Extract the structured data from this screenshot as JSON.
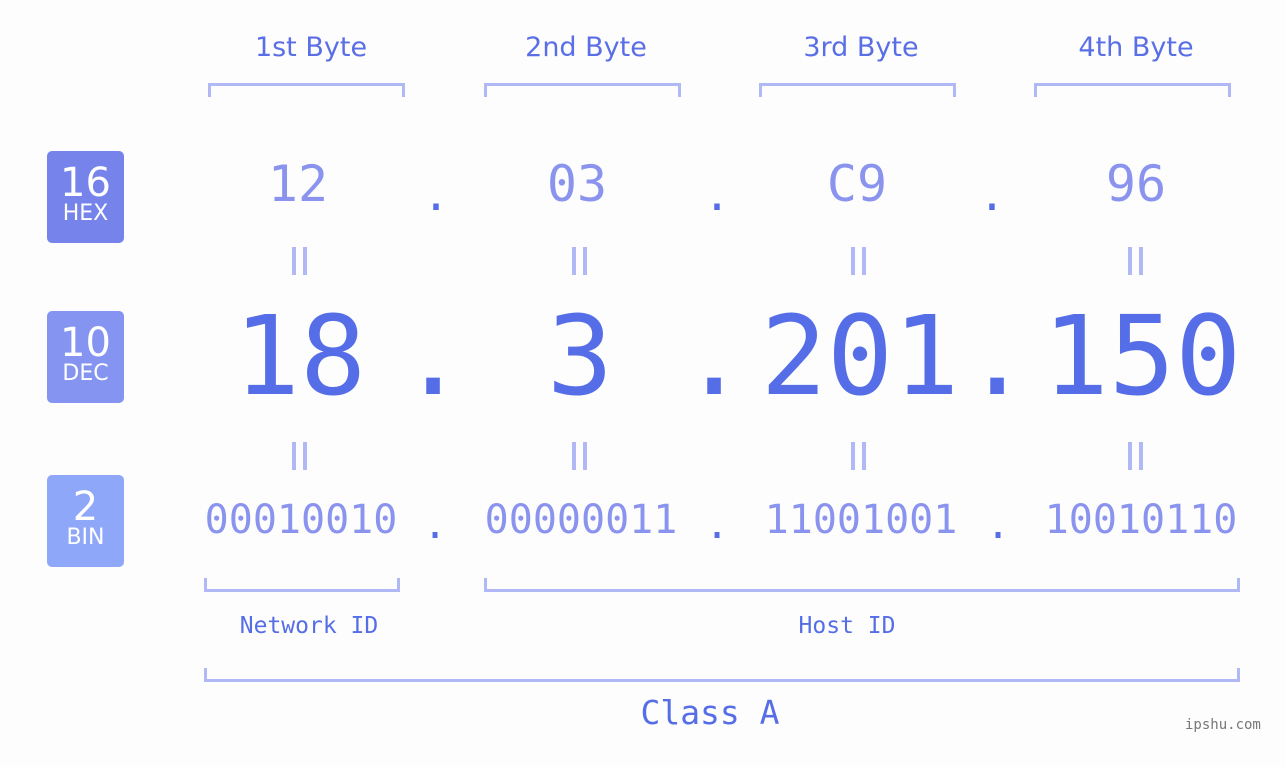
{
  "byte_headers": [
    "1st Byte",
    "2nd Byte",
    "3rd Byte",
    "4th Byte"
  ],
  "badges": {
    "hex": {
      "number": "16",
      "label": "HEX",
      "color": "#7683ea"
    },
    "dec": {
      "number": "10",
      "label": "DEC",
      "color": "#8594f0"
    },
    "bin": {
      "number": "2",
      "label": "BIN",
      "color": "#8fa7f8"
    }
  },
  "hex_values": [
    "12",
    "03",
    "C9",
    "96"
  ],
  "dec_values": [
    "18",
    "3",
    "201",
    "150"
  ],
  "bin_values": [
    "00010010",
    "00000011",
    "11001001",
    "10010110"
  ],
  "separator": ".",
  "network_id_label": "Network ID",
  "host_id_label": "Host ID",
  "class_label": "Class A",
  "watermark": "ipshu.com",
  "colors": {
    "primary": "#566de8",
    "light": "#8a94ee",
    "bracket": "#b0b8f6"
  }
}
